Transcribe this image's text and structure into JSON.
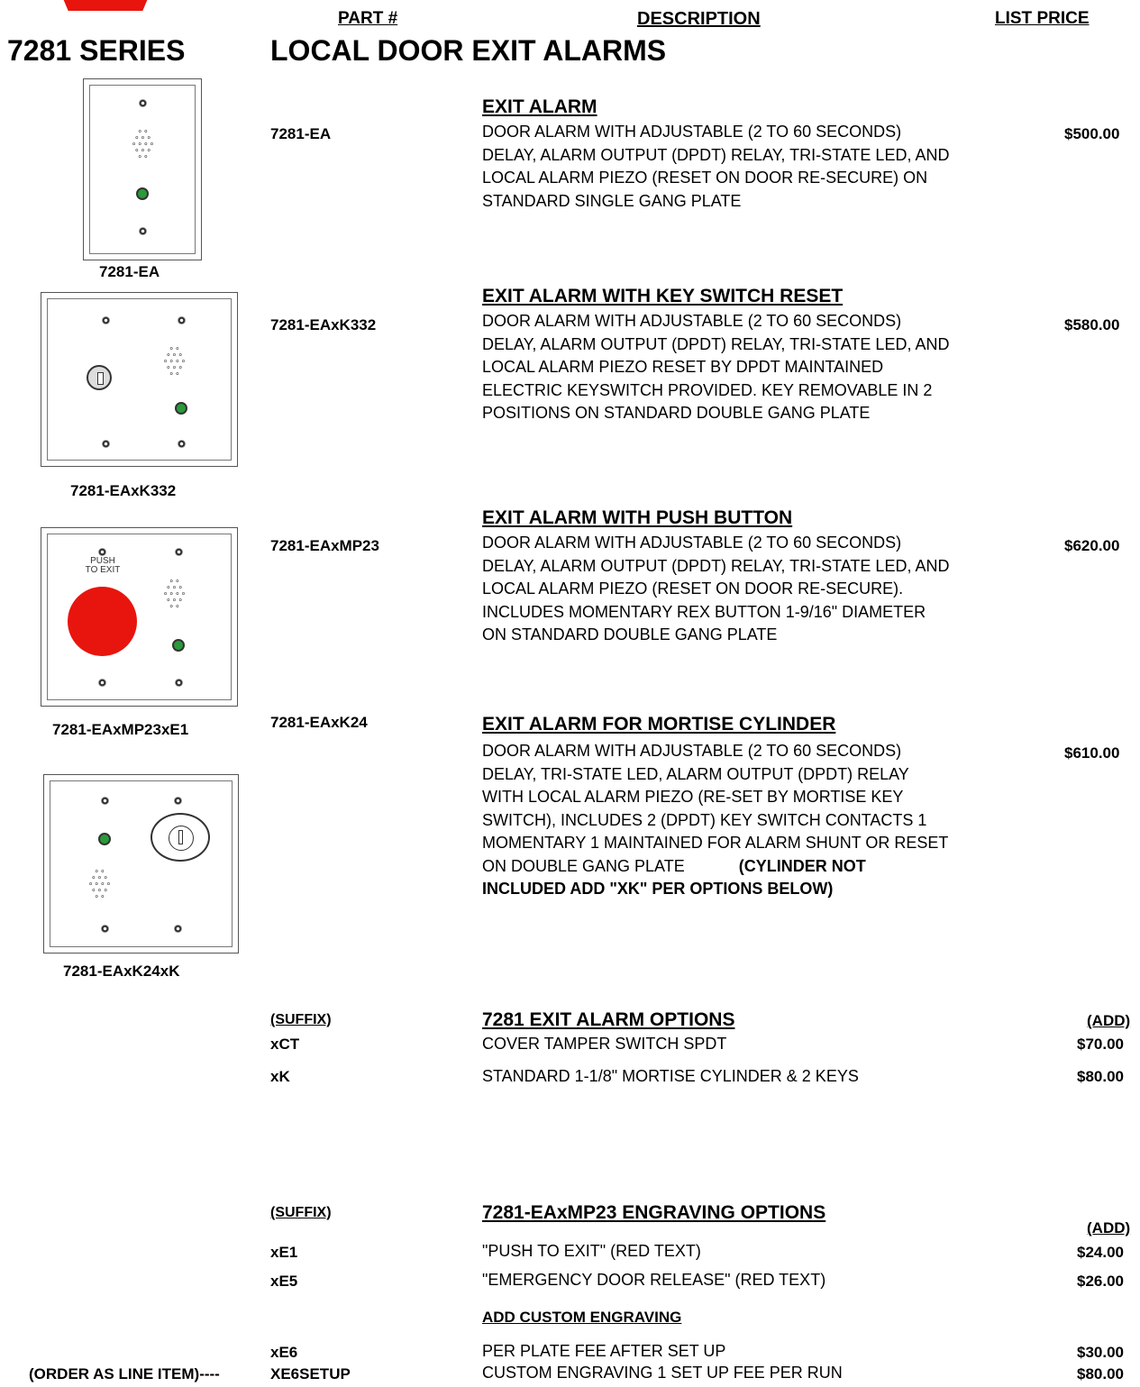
{
  "header": {
    "part_col": "PART #",
    "desc_col": "DESCRIPTION",
    "price_col": "LIST PRICE",
    "series_title": "7281 SERIES",
    "series_desc": "LOCAL DOOR EXIT ALARMS"
  },
  "products": [
    {
      "part": "7281-EA",
      "title": "EXIT ALARM",
      "desc": "DOOR ALARM WITH ADJUSTABLE (2 TO 60 SECONDS)  DELAY, ALARM OUTPUT (DPDT) RELAY, TRI-STATE LED, AND LOCAL ALARM PIEZO (RESET ON DOOR RE-SECURE) ON STANDARD SINGLE GANG PLATE",
      "price": "$500.00",
      "caption": "7281-EA"
    },
    {
      "part": "7281-EAxK332",
      "title": "EXIT ALARM WITH KEY SWITCH RESET",
      "desc": "DOOR ALARM WITH ADJUSTABLE (2 TO 60 SECONDS)  DELAY, ALARM OUTPUT (DPDT) RELAY, TRI-STATE LED, AND LOCAL ALARM PIEZO RESET BY DPDT MAINTAINED ELECTRIC KEYSWITCH PROVIDED. KEY REMOVABLE IN 2 POSITIONS ON STANDARD DOUBLE GANG PLATE",
      "price": "$580.00",
      "caption": "7281-EAxK332"
    },
    {
      "part": "7281-EAxMP23",
      "title": "EXIT ALARM WITH PUSH BUTTON",
      "desc": "DOOR ALARM WITH ADJUSTABLE (2 TO 60 SECONDS)  DELAY, ALARM OUTPUT (DPDT) RELAY, TRI-STATE LED, AND LOCAL ALARM PIEZO (RESET ON DOOR RE-SECURE). INCLUDES MOMENTARY REX BUTTON 1-9/16\" DIAMETER ON STANDARD DOUBLE GANG PLATE",
      "price": "$620.00",
      "caption": "7281-EAxMP23xE1",
      "button_text": "PUSH TO EXIT"
    },
    {
      "part": "7281-EAxK24",
      "title": "EXIT ALARM FOR MORTISE CYLINDER",
      "desc": "DOOR ALARM WITH ADJUSTABLE (2 TO 60 SECONDS) DELAY, TRI-STATE LED, ALARM OUTPUT (DPDT) RELAY WITH LOCAL ALARM PIEZO (RE-SET BY MORTISE KEY SWITCH), INCLUDES 2 (DPDT) KEY SWITCH CONTACTS  1 MOMENTARY 1 MAINTAINED FOR  ALARM SHUNT OR RESET ON DOUBLE GANG PLATE",
      "desc_bold": "(CYLINDER NOT INCLUDED ADD \"XK\" PER OPTIONS BELOW)",
      "price": "$610.00",
      "caption": "7281-EAxK24xK"
    }
  ],
  "options": {
    "suffix_label": "(SUFFIX)",
    "title": "7281   EXIT ALARM OPTIONS",
    "add_label": "(ADD)",
    "items": [
      {
        "code": "xCT",
        "name": "COVER TAMPER SWITCH SPDT",
        "price": "$70.00"
      },
      {
        "code": "xK",
        "name": "STANDARD 1-1/8\" MORTISE CYLINDER & 2 KEYS",
        "price": "$80.00"
      }
    ]
  },
  "engraving": {
    "suffix_label": "(SUFFIX)",
    "title": "7281-EAxMP23  ENGRAVING OPTIONS",
    "add_label": "(ADD)",
    "items": [
      {
        "code": "xE1",
        "name": "\"PUSH TO EXIT\"    (RED TEXT)",
        "price": "$24.00"
      },
      {
        "code": "xE5",
        "name": "\"EMERGENCY DOOR RELEASE\"     (RED TEXT)",
        "price": "$26.00"
      }
    ],
    "custom_title": "ADD CUSTOM ENGRAVING",
    "custom_items": [
      {
        "code": "xE6",
        "name": "PER PLATE FEE AFTER SET UP",
        "price": "$30.00"
      },
      {
        "code": "XE6SETUP",
        "name": "CUSTOM ENGRAVING 1 SET UP FEE PER RUN",
        "price": "$80.00",
        "prefix": "(ORDER AS LINE ITEM)----"
      }
    ]
  },
  "colors": {
    "button_red": "#e8150e",
    "led_green": "#2a9a3a",
    "logo_red": "#e8150e"
  }
}
